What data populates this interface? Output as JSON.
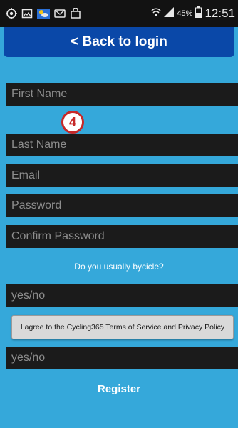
{
  "status_bar": {
    "icons": [
      "location-icon",
      "image-icon",
      "weather-icon",
      "message-icon",
      "bag-icon",
      "wifi-icon",
      "signal-icon",
      "battery-icon"
    ],
    "battery_percent": "45%",
    "time": "12:51"
  },
  "header": {
    "back_label": "< Back to login",
    "color": "#0a48a8"
  },
  "form": {
    "first_name_placeholder": "First Name",
    "last_name_placeholder": "Last Name",
    "email_placeholder": "Email",
    "password_placeholder": "Password",
    "confirm_password_placeholder": "Confirm Password",
    "bicycle_question": "Do you usually bycicle?",
    "bicycle_answer_placeholder": "yes/no",
    "terms_label": "I agree to the Cycling365 Terms of Service and Privacy Policy",
    "terms_answer_placeholder": "yes/no",
    "register_label": "Register"
  },
  "annotation": {
    "step_number": "4",
    "color": "#c62828"
  },
  "colors": {
    "background": "#35a8da",
    "field": "#1b1b1b"
  }
}
